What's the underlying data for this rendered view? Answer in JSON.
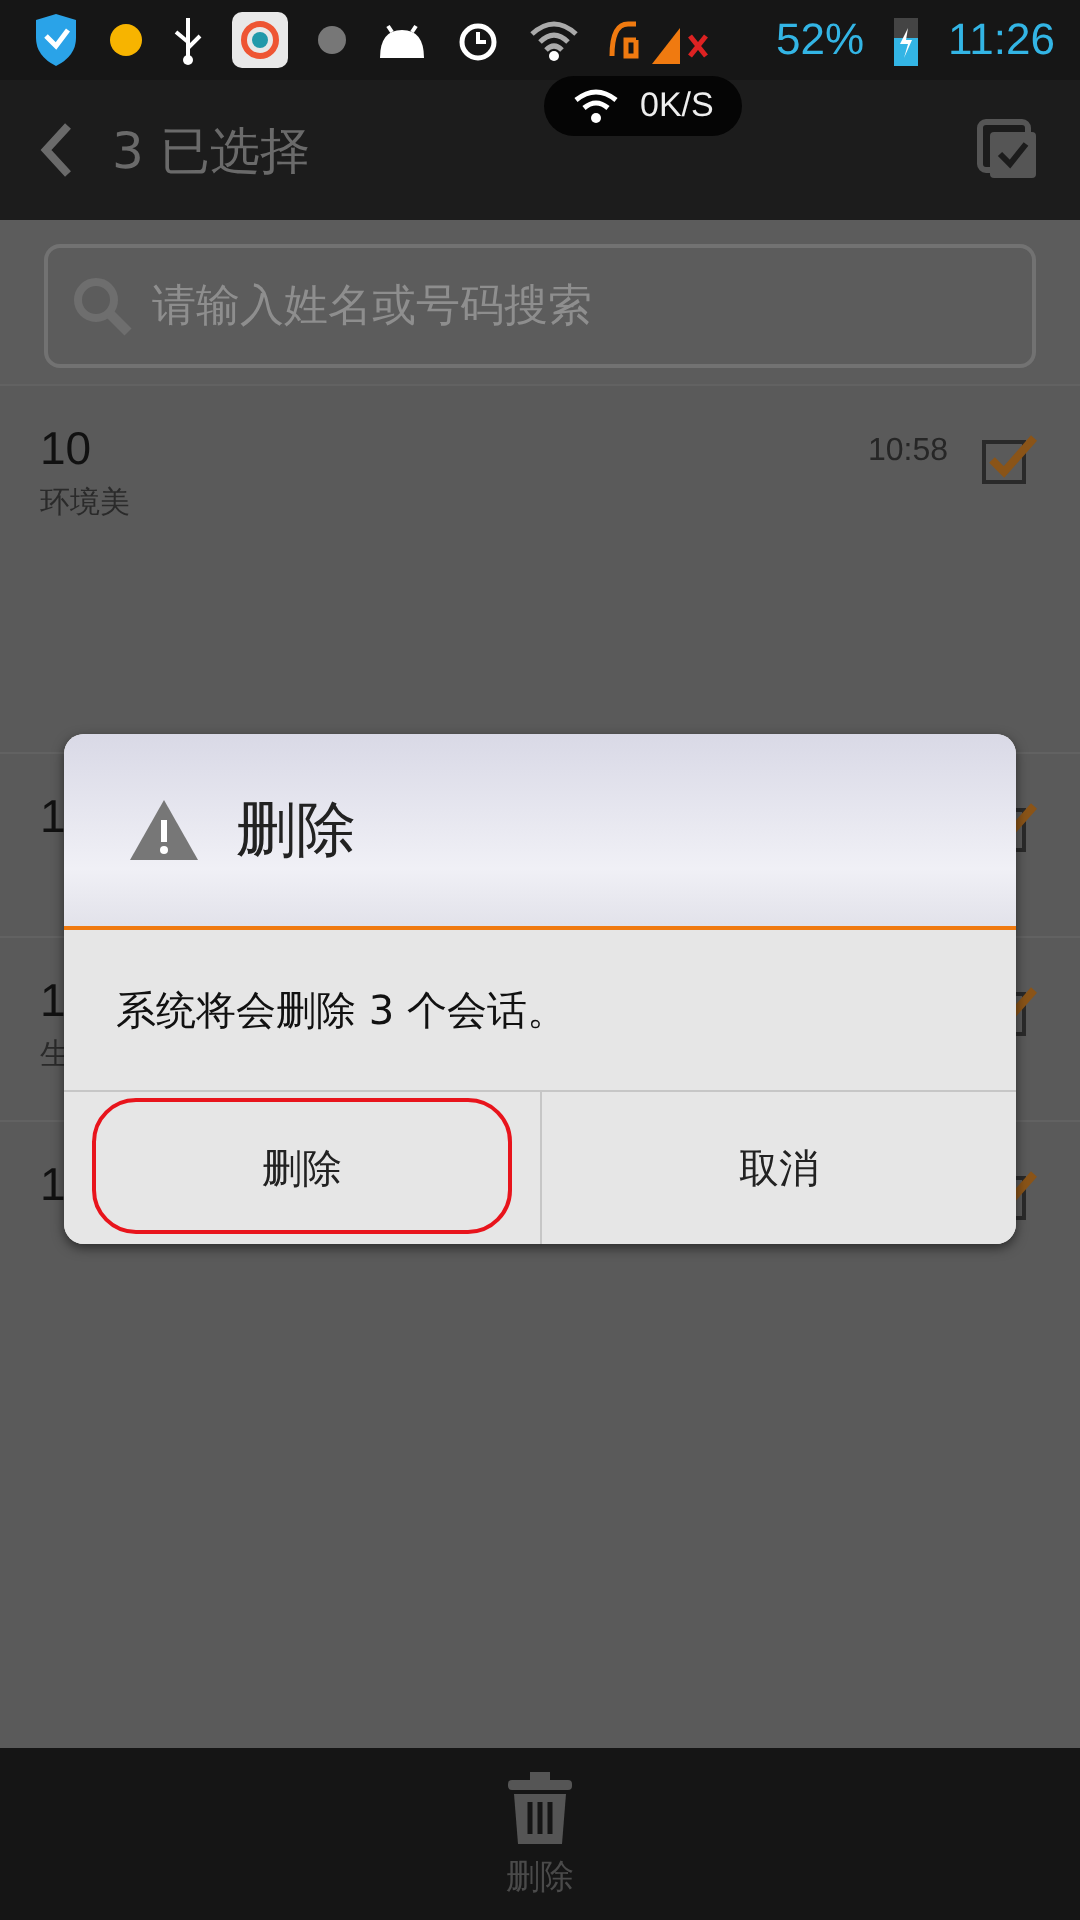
{
  "status_bar": {
    "battery": "52%",
    "time": "11:26"
  },
  "header": {
    "title": "3 已选择",
    "speed": "0K/S"
  },
  "search": {
    "placeholder": "请输入姓名或号码搜索"
  },
  "conversations": [
    {
      "title": "10",
      "subtitle": "环境美",
      "time": "10:58",
      "checked": true
    },
    {
      "title": "1",
      "checked": true
    },
    {
      "title": "1",
      "subtitle": "生",
      "checked": true
    },
    {
      "title": "1",
      "checked": true
    }
  ],
  "dialog": {
    "title": "删除",
    "message": "系统将会删除 3 个会话。",
    "buttons": [
      {
        "label": "删除",
        "highlighted": true
      },
      {
        "label": "取消",
        "highlighted": false
      }
    ]
  },
  "bottom_bar": {
    "action": "删除"
  }
}
